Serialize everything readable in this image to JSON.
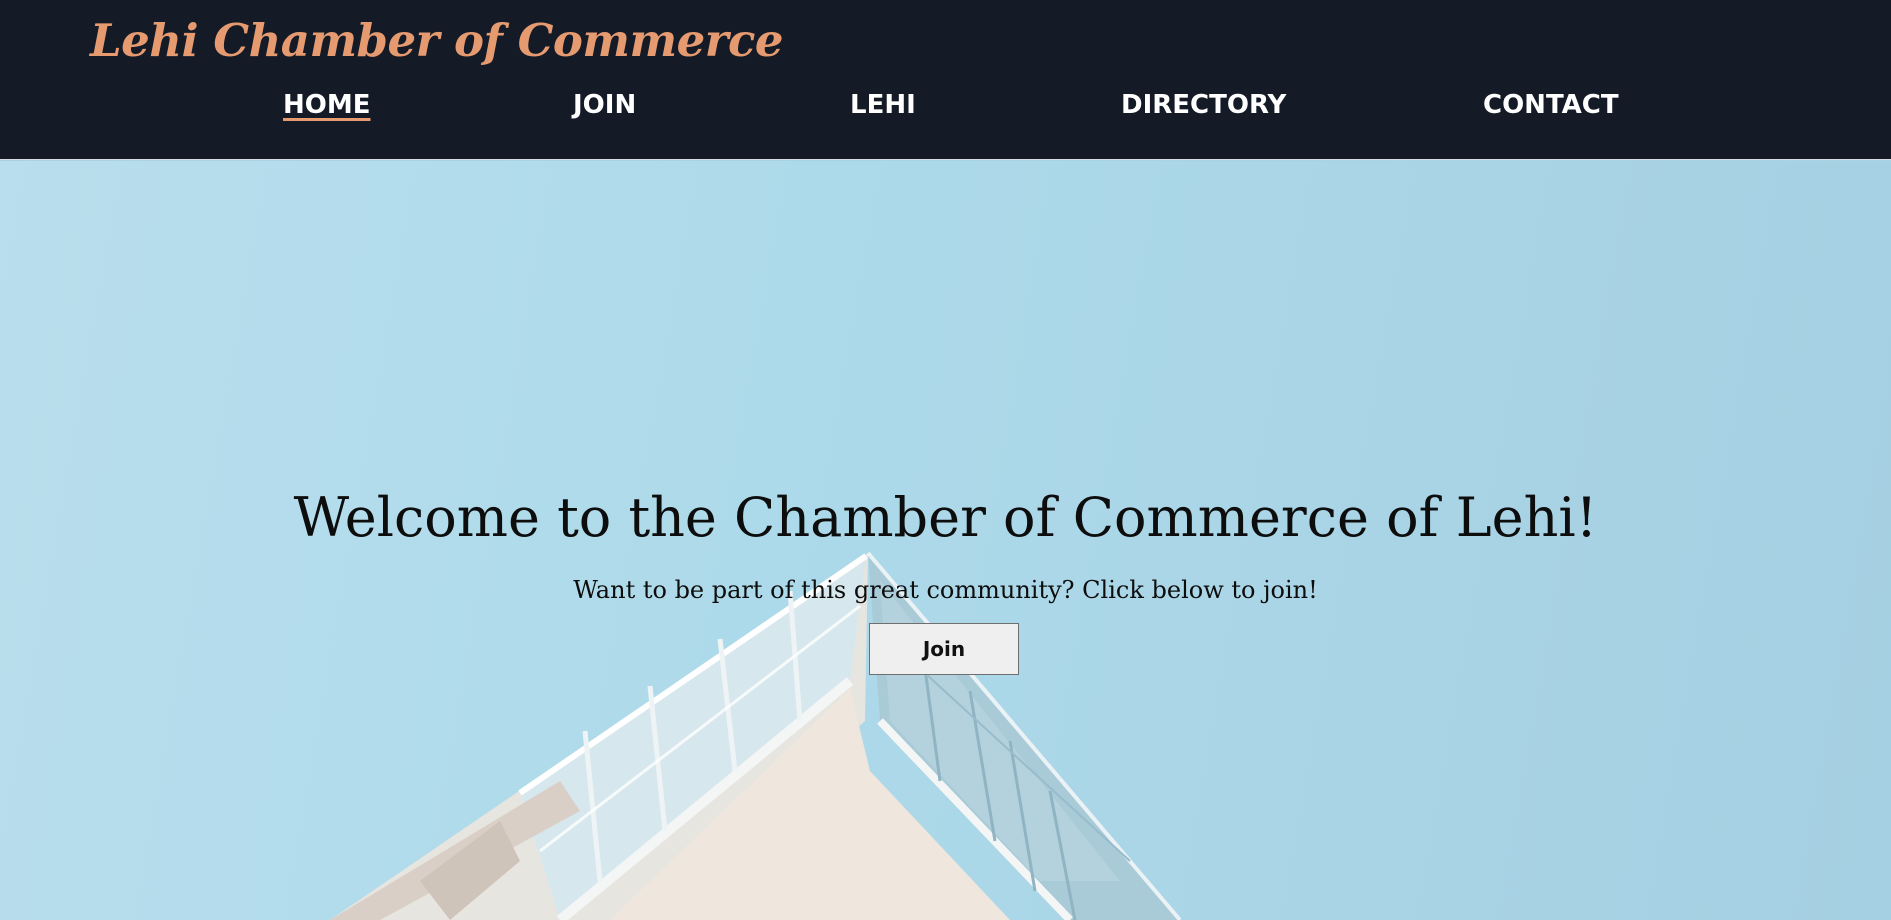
{
  "header": {
    "brand": "Lehi Chamber of Commerce",
    "nav": {
      "home": "HOME",
      "join": "JOIN",
      "lehi": "LEHI",
      "directory": "DIRECTORY",
      "contact": "CONTACT",
      "active": "HOME"
    }
  },
  "hero": {
    "title": "Welcome to the Chamber of Commerce of Lehi!",
    "subtitle": "Want to be part of this great community? Click below to join!",
    "button_label": "Join"
  },
  "colors": {
    "header_bg": "#141b27",
    "brand": "#e69a70",
    "nav_text": "#ffffff",
    "sky": "#addaea"
  }
}
